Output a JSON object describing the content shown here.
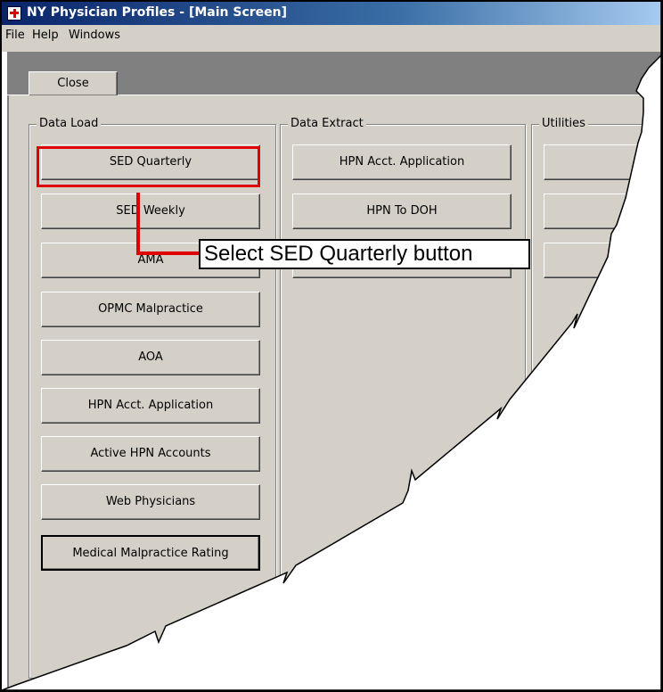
{
  "window": {
    "title": "NY Physician Profiles - [Main Screen]",
    "icon": "red-cross-icon"
  },
  "menu": {
    "file": "File",
    "help": "Help",
    "windows": "Windows"
  },
  "toolbar": {
    "close_label": "Close"
  },
  "data_load": {
    "label": "Data Load",
    "buttons": [
      "SED Quarterly",
      "SED Weekly",
      "AMA",
      "OPMC Malpractice",
      "AOA",
      "HPN Acct. Application",
      "Active HPN Accounts",
      "Web Physicians",
      "Medical Malpractice Rating"
    ]
  },
  "data_extract": {
    "label": "Data Extract",
    "buttons": [
      "HPN Acct. Application",
      "HPN To DOH"
    ]
  },
  "utilities": {
    "label": "Utilities"
  },
  "callout": {
    "text": "Select SED Quarterly button",
    "color": "#e00000"
  }
}
